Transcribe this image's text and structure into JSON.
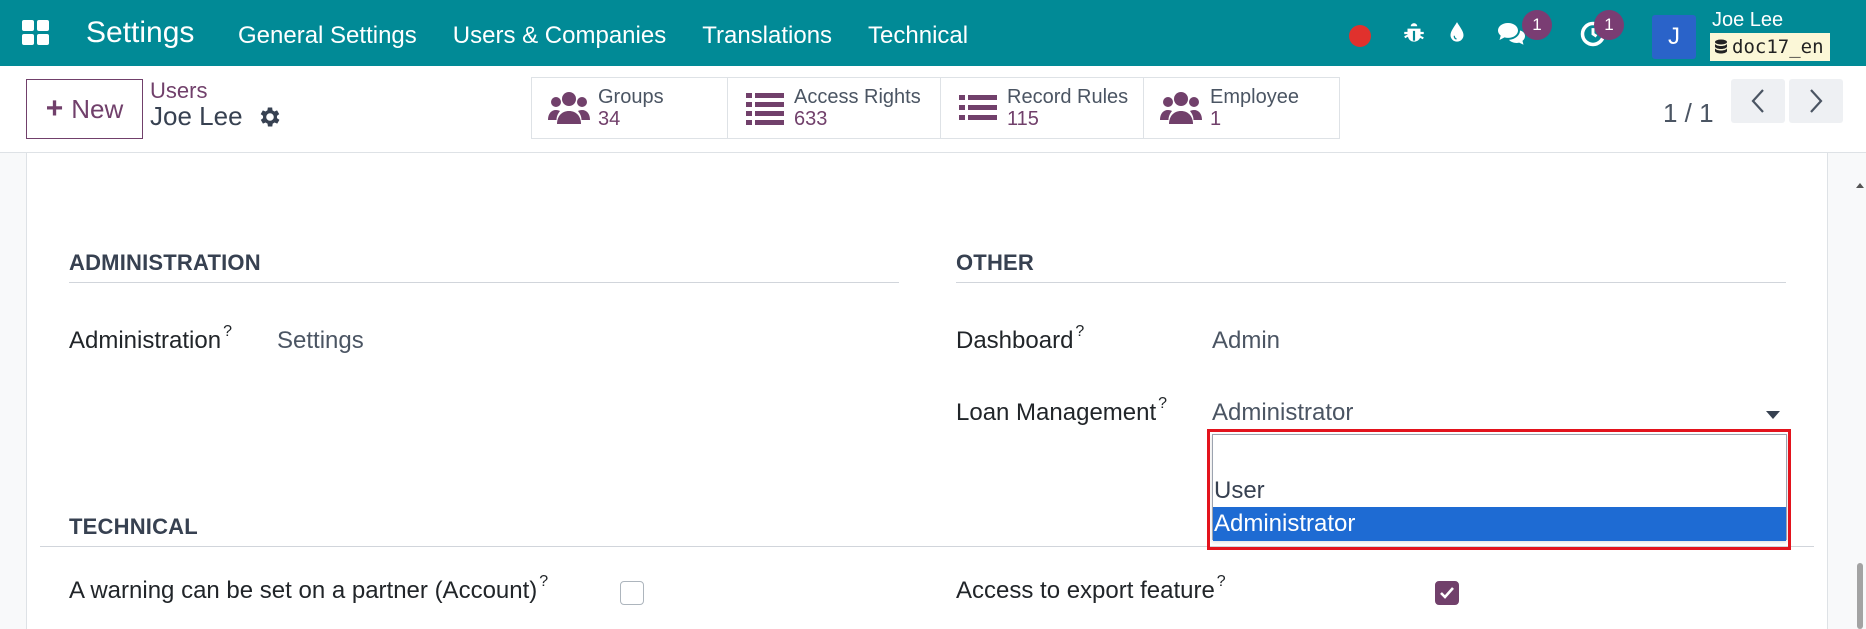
{
  "navbar": {
    "app_title": "Settings",
    "menu": [
      "General Settings",
      "Users & Companies",
      "Translations",
      "Technical"
    ],
    "messages_badge": "1",
    "activities_badge": "1",
    "avatar_initial": "J",
    "user_name": "Joe Lee",
    "database": "doc17_en",
    "colors": {
      "bar": "#018a96",
      "record_dot": "#e0312d",
      "badge": "#7a3d73",
      "avatar": "#2a63c9"
    }
  },
  "control_panel": {
    "new_label": "New",
    "breadcrumb": "Users",
    "record_name": "Joe Lee",
    "smart_buttons": [
      {
        "label": "Groups",
        "value": "34",
        "icon": "users-icon"
      },
      {
        "label": "Access Rights",
        "value": "633",
        "icon": "list-icon"
      },
      {
        "label": "Record Rules",
        "value": "115",
        "icon": "list-icon"
      },
      {
        "label": "Employee",
        "value": "1",
        "icon": "users-icon"
      }
    ],
    "pager": "1 / 1"
  },
  "form": {
    "administration": {
      "title": "ADMINISTRATION",
      "field_label": "Administration",
      "field_value": "Settings"
    },
    "other": {
      "title": "OTHER",
      "dashboard_label": "Dashboard",
      "dashboard_value": "Admin",
      "loan_label": "Loan Management",
      "loan_value": "Administrator",
      "loan_options": [
        "",
        "User",
        "Administrator"
      ]
    },
    "technical": {
      "title": "TECHNICAL",
      "warning_label": "A warning can be set on a partner (Account)",
      "warning_checked": false,
      "export_label": "Access to export feature",
      "export_checked": true
    },
    "help_marker": "?"
  },
  "accent_color": "#71406b",
  "highlight_color": "#e3131d"
}
